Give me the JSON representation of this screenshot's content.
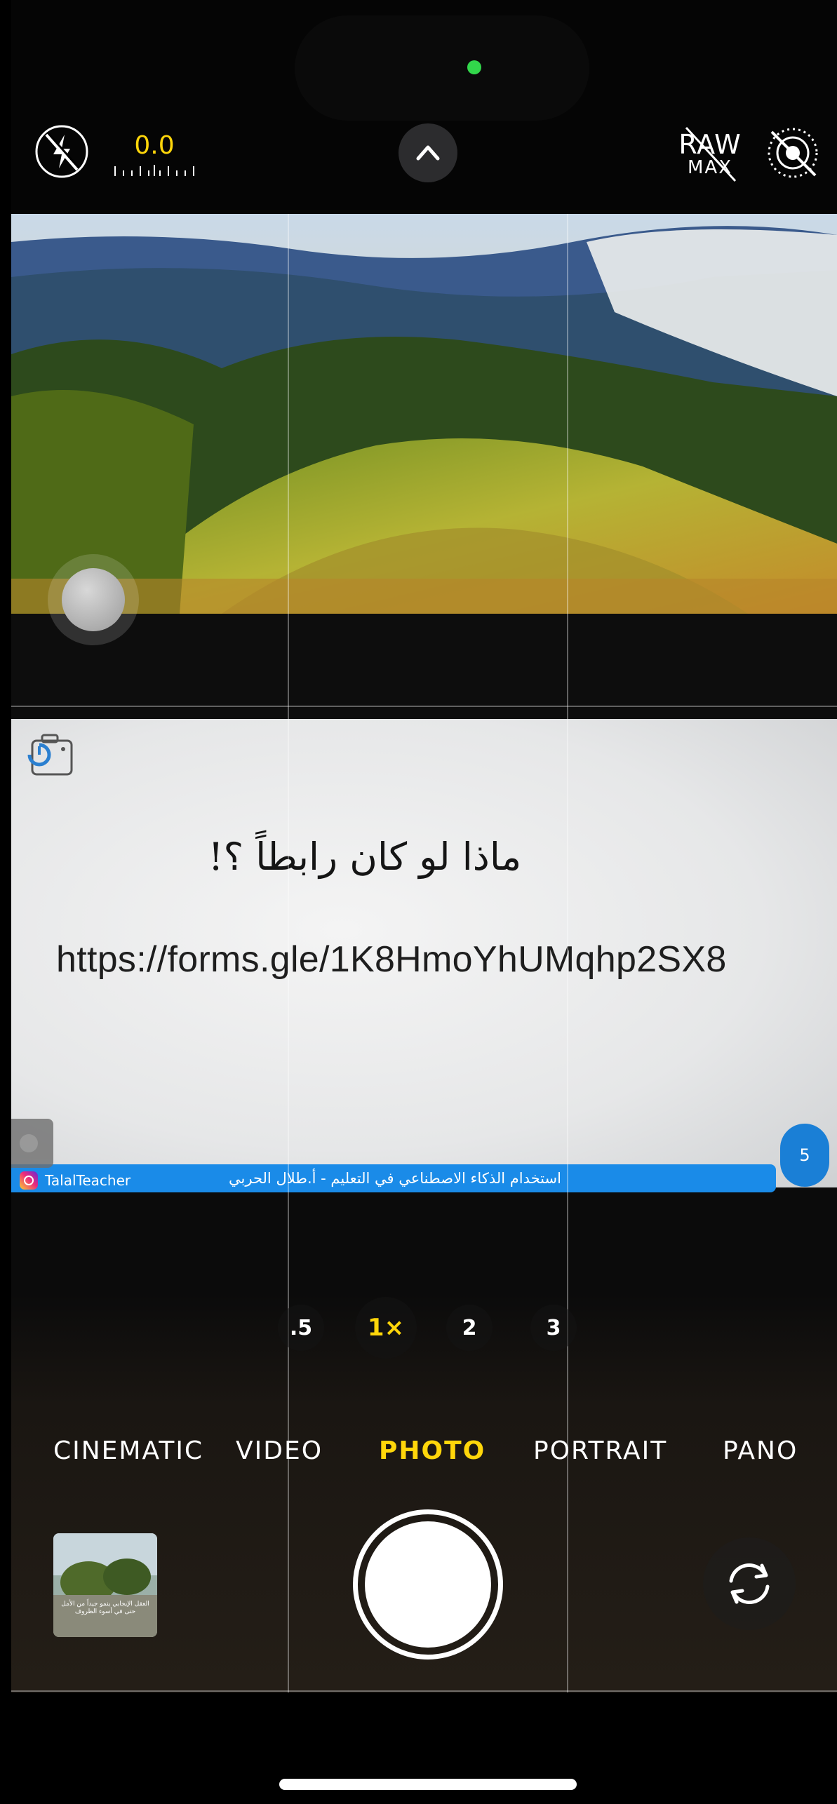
{
  "top_controls": {
    "exposure_value": "0.0",
    "raw_label": "RAW",
    "raw_sub_label": "MAX",
    "icons": [
      "flash-off-icon",
      "chevron-up-icon",
      "live-photo-off-icon"
    ]
  },
  "viewfinder": {
    "slide_title": "ماذا لو كان رابطاً ؟!",
    "slide_url": "https://forms.gle/1K8HmoYhUMqhp2SX8",
    "footer_handle": "TalalTeacher",
    "footer_text": "استخدام الذكاء الاصطناعي في التعليم - أ.طلال الحربي",
    "page_number": "5"
  },
  "zoom_levels": [
    ".5",
    "1×",
    "2",
    "3"
  ],
  "zoom_active": "1×",
  "modes": [
    "CINEMATIC",
    "VIDEO",
    "PHOTO",
    "PORTRAIT",
    "PANO"
  ],
  "mode_active": "PHOTO",
  "thumbnail_caption": "العقل الإيجابي ينمو جيداً من الأمل حتى في أسوء الظروف",
  "colors": {
    "accent": "#ffd60a",
    "indicator": "#32d74b",
    "slide_band": "#1a8be8"
  }
}
